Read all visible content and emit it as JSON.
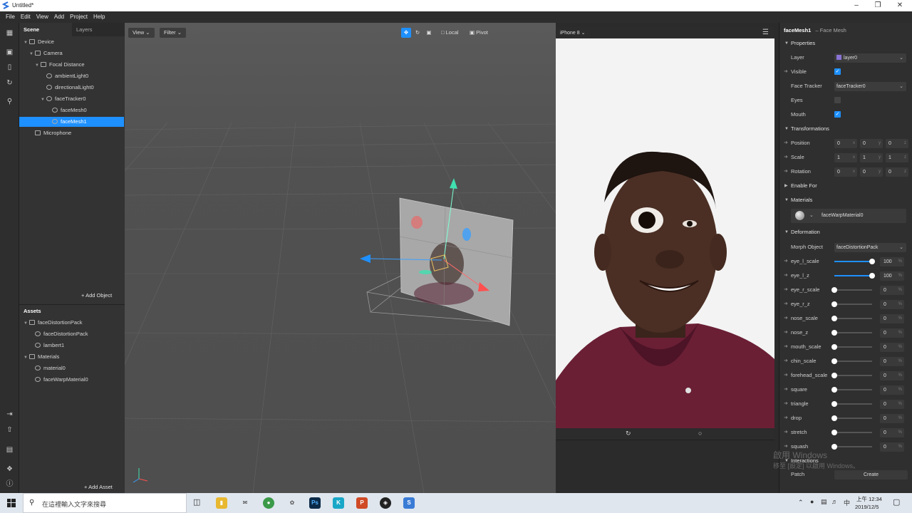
{
  "window": {
    "title": "Untitled*"
  },
  "menu": [
    "File",
    "Edit",
    "View",
    "Add",
    "Project",
    "Help"
  ],
  "scene_panel": {
    "tabs": [
      "Scene",
      "Layers"
    ],
    "tree": [
      {
        "label": "Device",
        "depth": 0,
        "expanded": true
      },
      {
        "label": "Camera",
        "depth": 1,
        "expanded": true
      },
      {
        "label": "Focal Distance",
        "depth": 2,
        "expanded": true
      },
      {
        "label": "ambientLight0",
        "depth": 3
      },
      {
        "label": "directionalLight0",
        "depth": 3
      },
      {
        "label": "faceTracker0",
        "depth": 3,
        "expanded": true
      },
      {
        "label": "faceMesh0",
        "depth": 4
      },
      {
        "label": "faceMesh1",
        "depth": 4,
        "selected": true
      },
      {
        "label": "Microphone",
        "depth": 1
      }
    ],
    "add_object": "Add Object"
  },
  "assets_panel": {
    "title": "Assets",
    "tree": [
      {
        "label": "faceDistortionPack",
        "depth": 0,
        "expanded": true
      },
      {
        "label": "faceDistortionPack",
        "depth": 1
      },
      {
        "label": "lambert1",
        "depth": 1
      },
      {
        "label": "Materials",
        "depth": 0,
        "expanded": true
      },
      {
        "label": "material0",
        "depth": 1
      },
      {
        "label": "faceWarpMaterial0",
        "depth": 1
      }
    ],
    "add_asset": "Add Asset"
  },
  "viewport": {
    "view_button": "View",
    "filter_button": "Filter",
    "local_button": "Local",
    "pivot_button": "Pivot"
  },
  "preview": {
    "device": "iPhone 8"
  },
  "inspector": {
    "object_name": "faceMesh1",
    "object_type": "– Face Mesh",
    "properties_title": "Properties",
    "layer_label": "Layer",
    "layer_value": "layer0",
    "visible_label": "Visible",
    "face_tracker_label": "Face Tracker",
    "face_tracker_value": "faceTracker0",
    "eyes_label": "Eyes",
    "mouth_label": "Mouth",
    "transformations_title": "Transformations",
    "position_label": "Position",
    "position": [
      "0",
      "0",
      "0"
    ],
    "scale_label": "Scale",
    "scale": [
      "1",
      "1",
      "1"
    ],
    "rotation_label": "Rotation",
    "rotation": [
      "0",
      "0",
      "0"
    ],
    "axes": [
      "x",
      "y",
      "z"
    ],
    "enable_for_title": "Enable For",
    "materials_title": "Materials",
    "material_value": "faceWarpMaterial0",
    "deformation_title": "Deformation",
    "morph_label": "Morph Object",
    "morph_value": "faceDistortionPack",
    "sliders": [
      {
        "label": "eye_l_scale",
        "value": "100",
        "level": 1.0
      },
      {
        "label": "eye_l_z",
        "value": "100",
        "level": 1.0
      },
      {
        "label": "eye_r_scale",
        "value": "0",
        "level": 0
      },
      {
        "label": "eye_r_z",
        "value": "0",
        "level": 0
      },
      {
        "label": "nose_scale",
        "value": "0",
        "level": 0
      },
      {
        "label": "nose_z",
        "value": "0",
        "level": 0
      },
      {
        "label": "mouth_scale",
        "value": "0",
        "level": 0
      },
      {
        "label": "chin_scale",
        "value": "0",
        "level": 0
      },
      {
        "label": "forehead_scale",
        "value": "0",
        "level": 0
      },
      {
        "label": "square",
        "value": "0",
        "level": 0
      },
      {
        "label": "triangle",
        "value": "0",
        "level": 0
      },
      {
        "label": "drop",
        "value": "0",
        "level": 0
      },
      {
        "label": "stretch",
        "value": "0",
        "level": 0
      },
      {
        "label": "squash",
        "value": "0",
        "level": 0
      }
    ],
    "pct": "%",
    "interactions_title": "Interactions",
    "patch_label": "Patch",
    "create_button": "Create"
  },
  "watermark": {
    "line1": "啟用 Windows",
    "line2": "移至 [設定] 以啟用 Windows。"
  },
  "taskbar": {
    "search_placeholder": "在這裡輸入文字來搜尋",
    "time": "上午 12:34",
    "date": "2019/12/5"
  }
}
